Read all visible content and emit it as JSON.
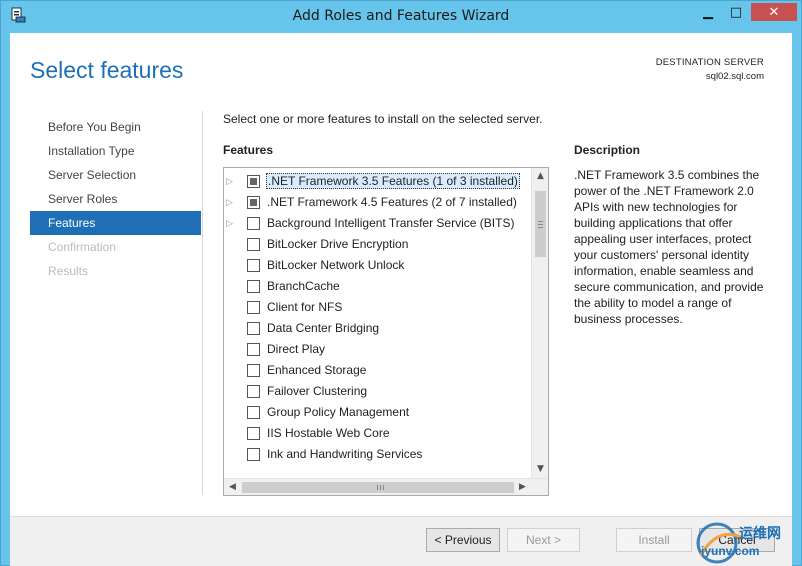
{
  "window": {
    "title": "Add Roles and Features Wizard",
    "controls": {
      "minimize": "▁",
      "maximize": "□",
      "close": "✕"
    }
  },
  "header": {
    "page_title": "Select features",
    "destination_label": "DESTINATION SERVER",
    "destination_value": "sql02.sql.com"
  },
  "nav": {
    "items": [
      {
        "label": "Before You Begin",
        "state": "normal"
      },
      {
        "label": "Installation Type",
        "state": "normal"
      },
      {
        "label": "Server Selection",
        "state": "normal"
      },
      {
        "label": "Server Roles",
        "state": "normal"
      },
      {
        "label": "Features",
        "state": "active"
      },
      {
        "label": "Confirmation",
        "state": "disabled"
      },
      {
        "label": "Results",
        "state": "disabled"
      }
    ]
  },
  "main": {
    "instruction": "Select one or more features to install on the selected server.",
    "features_heading": "Features",
    "features": [
      {
        "label": ".NET Framework 3.5 Features (1 of 3 installed)",
        "expandable": true,
        "check": "partial",
        "selected": true
      },
      {
        "label": ".NET Framework 4.5 Features (2 of 7 installed)",
        "expandable": true,
        "check": "partial",
        "selected": false
      },
      {
        "label": "Background Intelligent Transfer Service (BITS)",
        "expandable": true,
        "check": "unchecked",
        "selected": false
      },
      {
        "label": "BitLocker Drive Encryption",
        "expandable": false,
        "check": "unchecked",
        "selected": false
      },
      {
        "label": "BitLocker Network Unlock",
        "expandable": false,
        "check": "unchecked",
        "selected": false
      },
      {
        "label": "BranchCache",
        "expandable": false,
        "check": "unchecked",
        "selected": false
      },
      {
        "label": "Client for NFS",
        "expandable": false,
        "check": "unchecked",
        "selected": false
      },
      {
        "label": "Data Center Bridging",
        "expandable": false,
        "check": "unchecked",
        "selected": false
      },
      {
        "label": "Direct Play",
        "expandable": false,
        "check": "unchecked",
        "selected": false
      },
      {
        "label": "Enhanced Storage",
        "expandable": false,
        "check": "unchecked",
        "selected": false
      },
      {
        "label": "Failover Clustering",
        "expandable": false,
        "check": "unchecked",
        "selected": false
      },
      {
        "label": "Group Policy Management",
        "expandable": false,
        "check": "unchecked",
        "selected": false
      },
      {
        "label": "IIS Hostable Web Core",
        "expandable": false,
        "check": "unchecked",
        "selected": false
      },
      {
        "label": "Ink and Handwriting Services",
        "expandable": false,
        "check": "unchecked",
        "selected": false
      }
    ],
    "description_heading": "Description",
    "description_text": ".NET Framework 3.5 combines the power of the .NET Framework 2.0 APIs with new technologies for building applications that offer appealing user interfaces, protect your customers' personal identity information, enable seamless and secure communication, and provide the ability to model a range of business processes."
  },
  "footer": {
    "previous_label": "< Previous",
    "next_label": "Next >",
    "install_label": "Install",
    "cancel_label": "Cancel"
  },
  "watermark": {
    "text": "运维网",
    "url": "iyunv.com"
  },
  "colors": {
    "accent": "#1e6fb5",
    "frame": "#67c4ea",
    "close_button": "#c75050"
  }
}
